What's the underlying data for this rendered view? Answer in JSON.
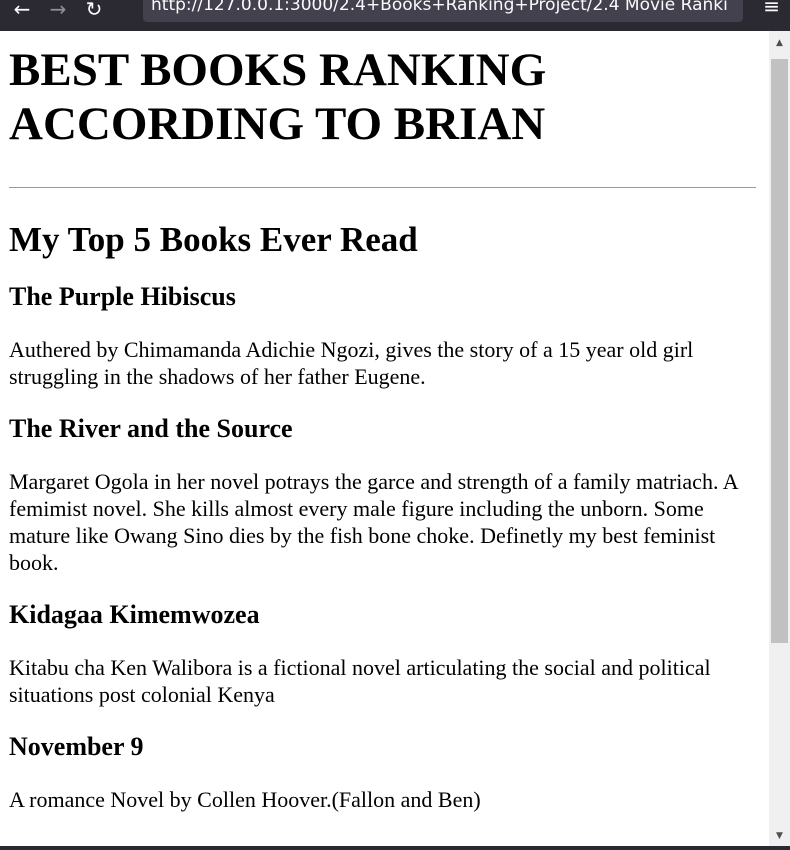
{
  "browser": {
    "back_icon": "arrow-left",
    "forward_icon": "arrow-right",
    "reload_icon": "reload",
    "url": "http://127.0.0.1:3000/2.4+Books+Ranking+Project/2.4 Movie Ranki",
    "menu_icon": "hamburger-menu"
  },
  "page": {
    "title_line1": "BEST BOOKS RANKING",
    "title_line2": "ACCORDING TO BRIAN",
    "subtitle": "My Top 5 Books Ever Read",
    "books": [
      {
        "title": "The Purple Hibiscus",
        "description": "Authered by Chimamanda Adichie Ngozi, gives the story of a 15 year old girl struggling in the shadows of her father Eugene."
      },
      {
        "title": "The River and the Source",
        "description": "Margaret Ogola in her novel potrays the garce and strength of a family matriach. A femimist novel. She kills almost every male figure including the unborn. Some mature like Owang Sino dies by the fish bone choke. Definetly my best feminist book."
      },
      {
        "title": "Kidagaa Kimemwozea",
        "description": "Kitabu cha Ken Walibora is a fictional novel articulating the social and political situations post colonial Kenya"
      },
      {
        "title": "November 9",
        "description": "A romance Novel by Collen Hoover.(Fallon and Ben)"
      }
    ]
  },
  "colors": {
    "toolbar_bg": "#2b2a33",
    "urlbar_bg": "#42414d",
    "scroll_thumb": "#c1c1c1"
  }
}
